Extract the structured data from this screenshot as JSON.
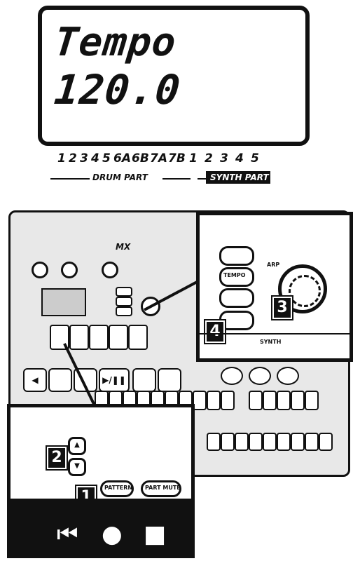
{
  "lcd": {
    "line1": "Tempo",
    "line2": "120.0"
  },
  "parts": {
    "numbers": [
      "1",
      "2",
      "3",
      "4",
      "5",
      "6A",
      "6B",
      "7A",
      "7B",
      "1",
      "2",
      "3",
      "4",
      "5"
    ],
    "drum_label": "DRUM PART",
    "synth_label": "SYNTH PART"
  },
  "device": {
    "brand_mark": "MX"
  },
  "callouts": {
    "badges": [
      "1",
      "2",
      "3",
      "4"
    ],
    "right_labels": [
      "TEMPO",
      "ARP",
      "SYNTH"
    ],
    "bottom_labels": [
      "PATTERN",
      "PART MUTE"
    ],
    "transport_icons": [
      "skip-back-icon",
      "record-icon",
      "stop-icon"
    ]
  },
  "colors": {
    "ink": "#111111",
    "panel": "#e8e8e8",
    "paper": "#ffffff"
  }
}
